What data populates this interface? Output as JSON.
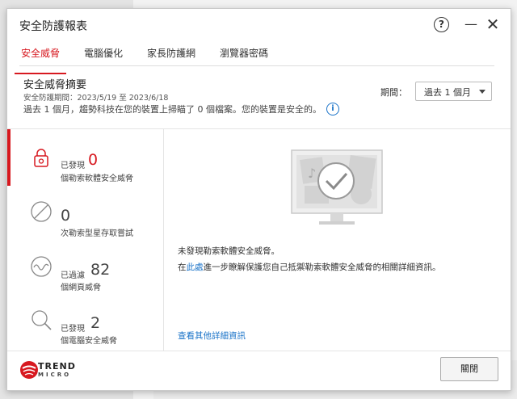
{
  "window": {
    "title": "安全防護報表"
  },
  "tabs": [
    {
      "label": "安全威脅",
      "active": true
    },
    {
      "label": "電腦優化"
    },
    {
      "label": "家長防護網"
    },
    {
      "label": "瀏覽器密碼"
    }
  ],
  "summary": {
    "title": "安全威脅摘要",
    "period": "安全防護期間：2023/5/19 至 2023/6/18",
    "description": "過去 1 個月，趨勢科技在您的裝置上掃瞄了 0 個檔案。您的裝置是安全的。"
  },
  "period_filter": {
    "label": "期間：",
    "selected": "過去 1 個月"
  },
  "items": [
    {
      "pre": "已發現",
      "count": "0",
      "sub": "個勒索軟體安全威脅",
      "icon": "lock-icon"
    },
    {
      "pre": "",
      "count": "0",
      "sub": "次勒索型星存取嘗試",
      "icon": "blocked-icon"
    },
    {
      "pre": "已過濾",
      "count": "82",
      "sub": "個網頁威脅",
      "icon": "web-shield-icon"
    },
    {
      "pre": "已發現",
      "count": "2",
      "sub": "個電腦安全威脅",
      "icon": "magnifier-icon"
    }
  ],
  "detail": {
    "no_threat": "未發現勒索軟體安全威脅。",
    "learn_prefix": "在",
    "learn_link": "此處",
    "learn_suffix": "進一步瞭解保護您自己抵禦勒索軟體安全威脅的相關詳細資訊。",
    "more_link": "查看其他詳細資訊"
  },
  "footer": {
    "logo_line1": "TREND",
    "logo_line2": "MICRO",
    "close_label": "關閉"
  },
  "colors": {
    "accent": "#d71920",
    "link": "#1a73c8"
  }
}
